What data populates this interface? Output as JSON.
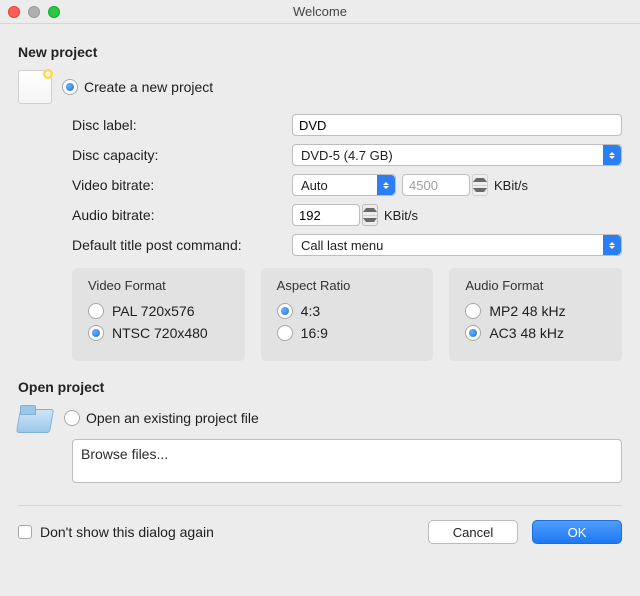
{
  "window": {
    "title": "Welcome"
  },
  "newProject": {
    "section": "New project",
    "modeLabel": "Create a new project",
    "fields": {
      "discLabel": {
        "label": "Disc label:",
        "value": "DVD"
      },
      "discCapacity": {
        "label": "Disc capacity:",
        "value": "DVD-5 (4.7 GB)"
      },
      "videoBitrate": {
        "label": "Video bitrate:",
        "select": "Auto",
        "number": "4500",
        "unit": "KBit/s"
      },
      "audioBitrate": {
        "label": "Audio bitrate:",
        "value": "192",
        "unit": "KBit/s"
      },
      "postCommand": {
        "label": "Default title post command:",
        "value": "Call last menu"
      }
    },
    "groups": {
      "videoFormat": {
        "title": "Video Format",
        "pal": "PAL 720x576",
        "ntsc": "NTSC 720x480"
      },
      "aspectRatio": {
        "title": "Aspect Ratio",
        "r43": "4:3",
        "r169": "16:9"
      },
      "audioFormat": {
        "title": "Audio Format",
        "mp2": "MP2 48 kHz",
        "ac3": "AC3 48 kHz"
      }
    }
  },
  "openProject": {
    "section": "Open project",
    "modeLabel": "Open an existing project file",
    "browse": "Browse files..."
  },
  "footer": {
    "dontShow": "Don't show this dialog again",
    "cancel": "Cancel",
    "ok": "OK"
  }
}
